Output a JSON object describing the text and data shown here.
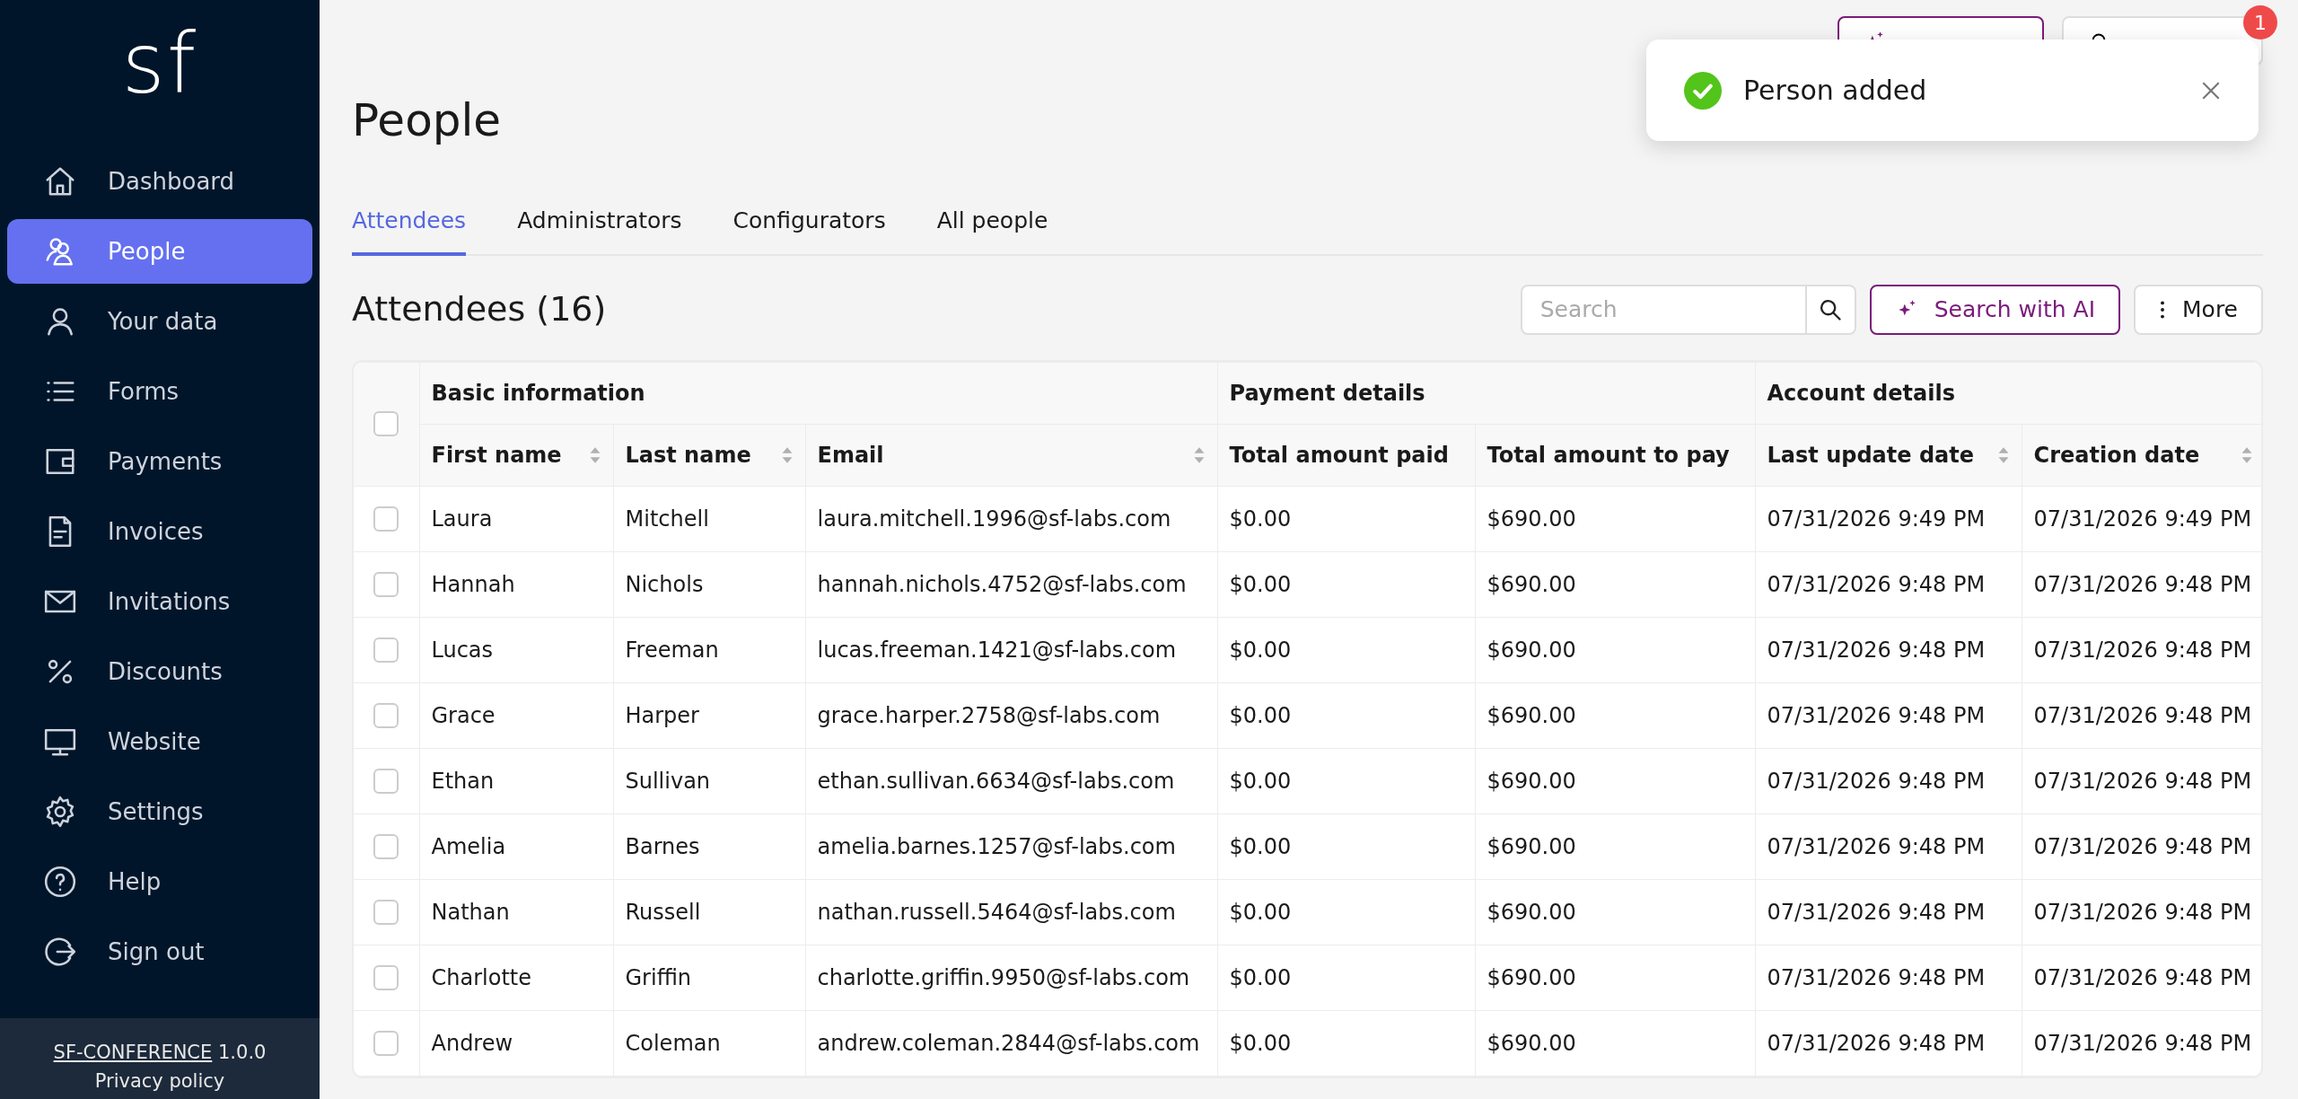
{
  "sidebar": {
    "logo": "sf",
    "items": [
      {
        "label": "Dashboard",
        "selected": false
      },
      {
        "label": "People",
        "selected": true
      },
      {
        "label": "Your data",
        "selected": false
      },
      {
        "label": "Forms",
        "selected": false
      },
      {
        "label": "Payments",
        "selected": false
      },
      {
        "label": "Invoices",
        "selected": false
      },
      {
        "label": "Invitations",
        "selected": false
      },
      {
        "label": "Discounts",
        "selected": false
      },
      {
        "label": "Website",
        "selected": false
      },
      {
        "label": "Settings",
        "selected": false
      },
      {
        "label": "Help",
        "selected": false
      },
      {
        "label": "Sign out",
        "selected": false
      }
    ],
    "footer": {
      "app_link": "SF-CONFERENCE",
      "version": "1.0.0",
      "privacy_link": "Privacy policy"
    }
  },
  "header": {
    "buttons": [
      {
        "kind": "ai"
      },
      {
        "kind": "notifications",
        "badge": "1"
      }
    ]
  },
  "toast": {
    "kind": "success",
    "message": "Person added"
  },
  "page": {
    "title": "People",
    "tabs": [
      {
        "label": "Attendees",
        "selected": true
      },
      {
        "label": "Administrators",
        "selected": false
      },
      {
        "label": "Configurators",
        "selected": false
      },
      {
        "label": "All people",
        "selected": false
      }
    ]
  },
  "section": {
    "title": "Attendees (16)",
    "search": {
      "placeholder": "Search"
    },
    "buttons": [
      {
        "label": "Search with AI",
        "kind": "ai"
      },
      {
        "label": "More",
        "kind": "more"
      }
    ]
  },
  "table": {
    "select_all": {
      "checked": false
    },
    "groups": [
      {
        "label": "Basic information",
        "columns": [
          {
            "label": "First name",
            "sortable": true
          },
          {
            "label": "Last name",
            "sortable": true
          },
          {
            "label": "Email",
            "sortable": true
          }
        ]
      },
      {
        "label": "Payment details",
        "columns": [
          {
            "label": "Total amount paid",
            "sortable": false
          },
          {
            "label": "Total amount to pay",
            "sortable": false
          }
        ]
      },
      {
        "label": "Account details",
        "columns": [
          {
            "label": "Last update date",
            "sortable": true
          },
          {
            "label": "Creation date",
            "sortable": true
          }
        ]
      }
    ],
    "rows": [
      {
        "checked": false,
        "cells": [
          "Laura",
          "Mitchell",
          "laura.mitchell.1996@sf-labs.com",
          "$0.00",
          "$690.00",
          "07/31/2026 9:49 PM",
          "07/31/2026 9:49 PM"
        ]
      },
      {
        "checked": false,
        "cells": [
          "Hannah",
          "Nichols",
          "hannah.nichols.4752@sf-labs.com",
          "$0.00",
          "$690.00",
          "07/31/2026 9:48 PM",
          "07/31/2026 9:48 PM"
        ]
      },
      {
        "checked": false,
        "cells": [
          "Lucas",
          "Freeman",
          "lucas.freeman.1421@sf-labs.com",
          "$0.00",
          "$690.00",
          "07/31/2026 9:48 PM",
          "07/31/2026 9:48 PM"
        ]
      },
      {
        "checked": false,
        "cells": [
          "Grace",
          "Harper",
          "grace.harper.2758@sf-labs.com",
          "$0.00",
          "$690.00",
          "07/31/2026 9:48 PM",
          "07/31/2026 9:48 PM"
        ]
      },
      {
        "checked": false,
        "cells": [
          "Ethan",
          "Sullivan",
          "ethan.sullivan.6634@sf-labs.com",
          "$0.00",
          "$690.00",
          "07/31/2026 9:48 PM",
          "07/31/2026 9:48 PM"
        ]
      },
      {
        "checked": false,
        "cells": [
          "Amelia",
          "Barnes",
          "amelia.barnes.1257@sf-labs.com",
          "$0.00",
          "$690.00",
          "07/31/2026 9:48 PM",
          "07/31/2026 9:48 PM"
        ]
      },
      {
        "checked": false,
        "cells": [
          "Nathan",
          "Russell",
          "nathan.russell.5464@sf-labs.com",
          "$0.00",
          "$690.00",
          "07/31/2026 9:48 PM",
          "07/31/2026 9:48 PM"
        ]
      },
      {
        "checked": false,
        "cells": [
          "Charlotte",
          "Griffin",
          "charlotte.griffin.9950@sf-labs.com",
          "$0.00",
          "$690.00",
          "07/31/2026 9:48 PM",
          "07/31/2026 9:48 PM"
        ]
      },
      {
        "checked": false,
        "cells": [
          "Andrew",
          "Coleman",
          "andrew.coleman.2844@sf-labs.com",
          "$0.00",
          "$690.00",
          "07/31/2026 9:48 PM",
          "07/31/2026 9:48 PM"
        ]
      }
    ]
  }
}
